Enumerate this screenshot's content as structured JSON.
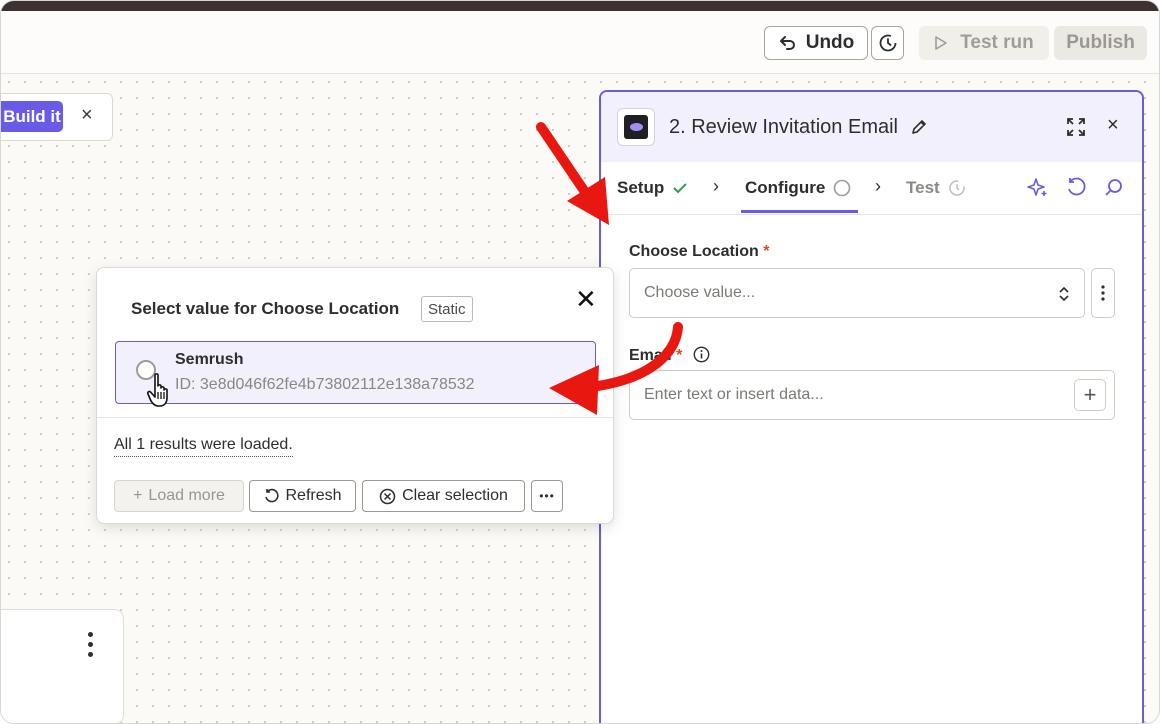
{
  "toolbar": {
    "undo_label": "Undo",
    "test_run_label": "Test run",
    "publish_label": "Publish"
  },
  "canvas": {
    "build_it_label": "Build it",
    "build_close": "×"
  },
  "panel": {
    "title": "2. Review Invitation Email",
    "close": "×",
    "tabs": [
      {
        "label": "Setup",
        "status": "complete"
      },
      {
        "label": "Configure",
        "status": "active"
      },
      {
        "label": "Test",
        "status": "pending"
      }
    ],
    "fields": {
      "location": {
        "label": "Choose Location",
        "required": "*",
        "placeholder": "Choose value..."
      },
      "email": {
        "label": "Email",
        "required": "*",
        "placeholder": "Enter text or insert data..."
      }
    }
  },
  "popup": {
    "title": "Select value for Choose Location",
    "badge": "Static",
    "close": "✕",
    "options": [
      {
        "name": "Semrush",
        "id": "ID: 3e8d046f62fe4b73802112e138a78532"
      }
    ],
    "status": "All 1 results were loaded.",
    "buttons": {
      "load_more": "Load more",
      "refresh": "Refresh",
      "clear": "Clear selection",
      "more": "•••"
    }
  },
  "colors": {
    "accent": "#695be8",
    "arrow": "#e8170f",
    "success": "#2f9e4f",
    "required": "#d64e1d"
  }
}
